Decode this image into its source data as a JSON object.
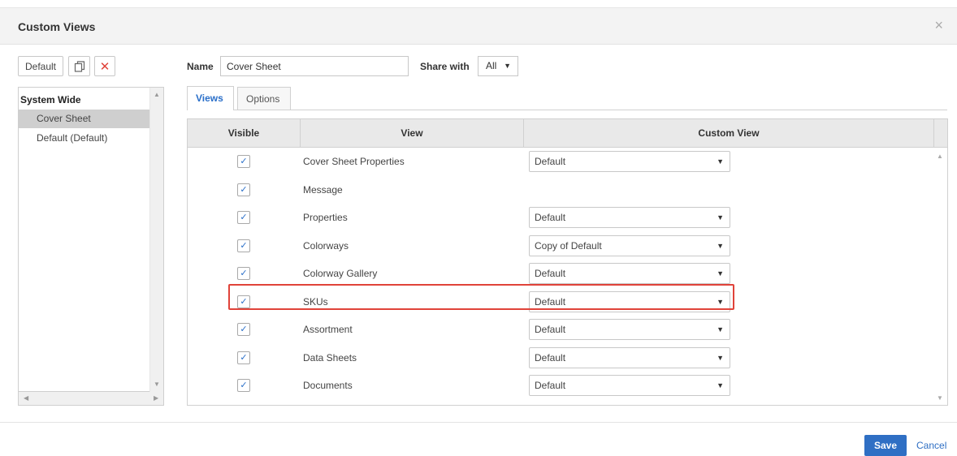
{
  "dialog": {
    "title": "Custom Views",
    "close_glyph": "×"
  },
  "toolbar": {
    "default_label": "Default",
    "copy_icon": "copy-icon",
    "delete_glyph": "✕"
  },
  "left_panel": {
    "group_label": "System Wide",
    "items": [
      {
        "label": "Cover Sheet",
        "selected": true
      },
      {
        "label": "Default (Default)",
        "selected": false
      }
    ]
  },
  "form": {
    "name_label": "Name",
    "name_value": "Cover Sheet",
    "share_label": "Share with",
    "share_value": "All"
  },
  "tabs": [
    {
      "label": "Views",
      "active": true
    },
    {
      "label": "Options",
      "active": false
    }
  ],
  "grid": {
    "columns": [
      "Visible",
      "View",
      "Custom View"
    ],
    "rows": [
      {
        "view": "Cover Sheet Properties",
        "visible": true,
        "custom_view": "Default"
      },
      {
        "view": "Message",
        "visible": true,
        "custom_view": null
      },
      {
        "view": "Properties",
        "visible": true,
        "custom_view": "Default"
      },
      {
        "view": "Colorways",
        "visible": true,
        "custom_view": "Copy of Default"
      },
      {
        "view": "Colorway Gallery",
        "visible": true,
        "custom_view": "Default"
      },
      {
        "view": "SKUs",
        "visible": true,
        "custom_view": "Default"
      },
      {
        "view": "Assortment",
        "visible": true,
        "custom_view": "Default"
      },
      {
        "view": "Data Sheets",
        "visible": true,
        "custom_view": "Default"
      },
      {
        "view": "Documents",
        "visible": true,
        "custom_view": "Default"
      }
    ],
    "highlight_color": "#e0433a"
  },
  "footer": {
    "save_label": "Save",
    "cancel_label": "Cancel"
  },
  "colors": {
    "accent": "#2f6fc4",
    "danger": "#e0433a",
    "selected_row": "#cfcfcf"
  }
}
